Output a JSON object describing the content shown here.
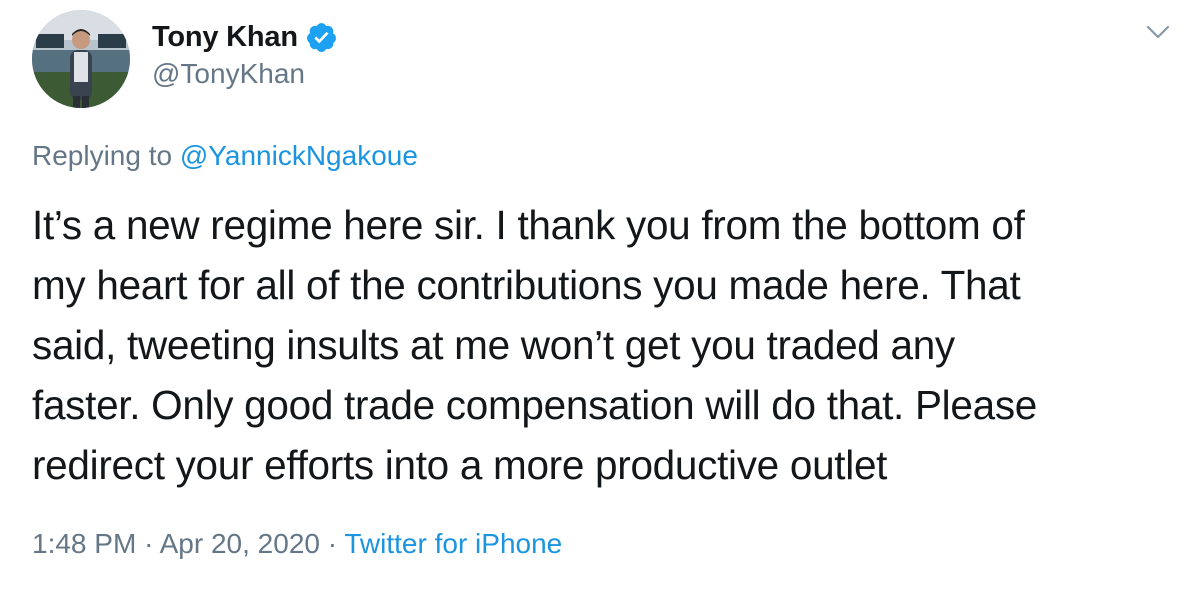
{
  "author": {
    "display_name": "Tony Khan",
    "handle": "@TonyKhan",
    "verified_icon": "verified-badge-icon",
    "avatar_icon": "profile-photo"
  },
  "reply": {
    "prefix": "Replying to",
    "mention": "@YannickNgakoue"
  },
  "tweet": {
    "lines": [
      "It’s a new regime here sir. I thank you from the bottom of",
      "my heart for all of the contributions you made here. That",
      "said, tweeting insults at me won’t get you traded any",
      "faster. Only good trade compensation will do that. Please",
      "redirect your efforts into a more productive outlet"
    ]
  },
  "meta": {
    "time": "1:48 PM",
    "separator_1": "·",
    "date": "Apr 20, 2020",
    "separator_2": "·",
    "source": "Twitter for iPhone"
  },
  "menu": {
    "caret_icon": "chevron-down-icon"
  },
  "colors": {
    "text": "#14171a",
    "secondary": "#657786",
    "link": "#1b95e0",
    "verified": "#1da1f2"
  }
}
